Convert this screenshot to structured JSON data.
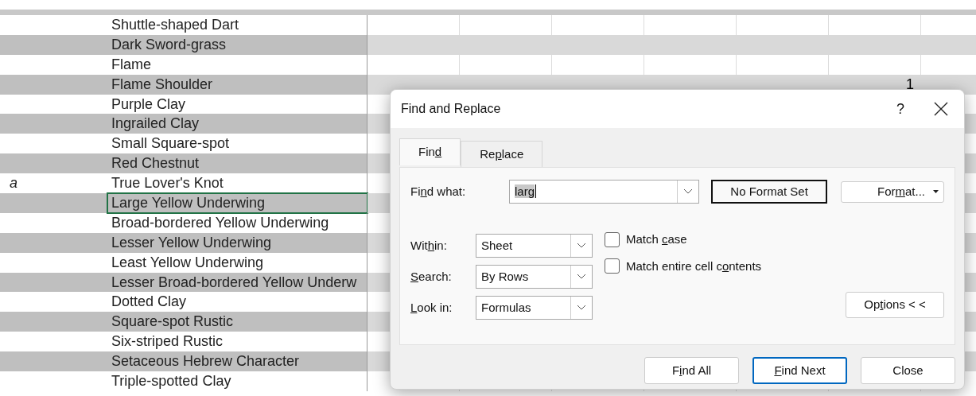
{
  "sheet": {
    "rows": [
      {
        "name": "Shuttle-shaped Dart",
        "selected": false
      },
      {
        "name": "Dark Sword-grass",
        "selected": false
      },
      {
        "name": "Flame",
        "selected": false
      },
      {
        "name": "Flame Shoulder",
        "selected": false,
        "column_8": "1"
      },
      {
        "name": "Purple Clay",
        "selected": false
      },
      {
        "name": "Ingrailed Clay",
        "selected": false
      },
      {
        "name": "Small Square-spot",
        "selected": false
      },
      {
        "name": "Red Chestnut",
        "selected": false
      },
      {
        "column_1": "a",
        "name": "True Lover's Knot",
        "selected": false
      },
      {
        "name": "Large Yellow Underwing",
        "selected": true
      },
      {
        "name": "Broad-bordered Yellow Underwing",
        "selected": false
      },
      {
        "name": "Lesser Yellow Underwing",
        "selected": false
      },
      {
        "name": "Least Yellow Underwing",
        "selected": false
      },
      {
        "name": "Lesser Broad-bordered Yellow Underw",
        "selected": false
      },
      {
        "name": "Dotted Clay",
        "selected": false
      },
      {
        "name": "Square-spot Rustic",
        "selected": false
      },
      {
        "name": "Six-striped Rustic",
        "selected": false
      },
      {
        "name": "Setaceous Hebrew Character",
        "selected": false
      },
      {
        "name": "Triple-spotted Clay",
        "selected": false
      }
    ]
  },
  "dialog": {
    "title": "Find and Replace",
    "help": "?",
    "tabs": [
      {
        "label": {
          "pre": "Fin",
          "key": "d"
        },
        "selected": true
      },
      {
        "label": {
          "pre": "Re",
          "key": "p",
          "post": "lace"
        },
        "selected": false
      }
    ],
    "find_what": {
      "label": {
        "pre": "Fi",
        "key": "n",
        "post": "d what:"
      },
      "value": "larg"
    },
    "format_status": "No Format Set",
    "format_button": {
      "pre": "For",
      "key": "m",
      "post": "at..."
    },
    "selects": [
      {
        "label": {
          "pre": "Wit",
          "key": "h",
          "post": "in:"
        },
        "value": "Sheet"
      },
      {
        "label": {
          "key": "S",
          "post": "earch:"
        },
        "value": "By Rows"
      },
      {
        "label": {
          "key": "L",
          "post": "ook in:"
        },
        "value": "Formulas"
      }
    ],
    "checkboxes": [
      {
        "label": {
          "pre": "Match ",
          "key": "c",
          "post": "ase"
        },
        "checked": false
      },
      {
        "label": {
          "pre": "Match entire cell c",
          "key": "o",
          "post": "ntents"
        },
        "checked": false
      }
    ],
    "options_button": {
      "pre": "Op",
      "key": "t",
      "post": "ions < <"
    },
    "buttons": [
      {
        "label": {
          "pre": "F",
          "key": "i",
          "post": "nd All"
        },
        "default": false
      },
      {
        "label": {
          "key": "F",
          "post": "ind Next"
        },
        "default": true
      },
      {
        "label": {
          "pre": "Close"
        },
        "default": false
      }
    ]
  }
}
